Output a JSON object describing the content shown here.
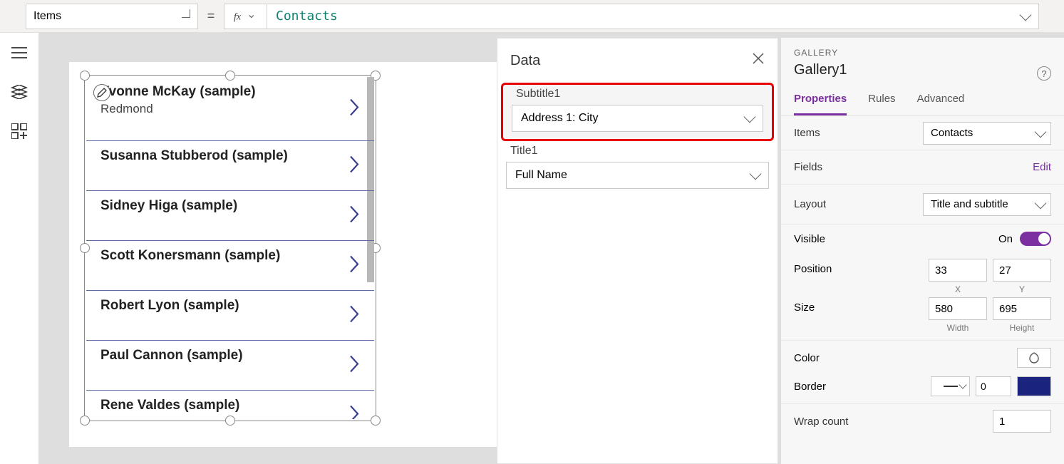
{
  "formula_bar": {
    "property_selected": "Items",
    "formula_value": "Contacts"
  },
  "gallery": {
    "items": [
      {
        "title": "Yvonne McKay (sample)",
        "subtitle": "Redmond"
      },
      {
        "title": "Susanna Stubberod (sample)",
        "subtitle": ""
      },
      {
        "title": "Sidney Higa (sample)",
        "subtitle": ""
      },
      {
        "title": "Scott Konersmann (sample)",
        "subtitle": ""
      },
      {
        "title": "Robert Lyon (sample)",
        "subtitle": ""
      },
      {
        "title": "Paul Cannon (sample)",
        "subtitle": ""
      },
      {
        "title": "Rene Valdes (sample)",
        "subtitle": ""
      }
    ]
  },
  "data_panel": {
    "title": "Data",
    "subtitle_field": {
      "label": "Subtitle1",
      "value": "Address 1: City"
    },
    "title_field": {
      "label": "Title1",
      "value": "Full Name"
    }
  },
  "properties_panel": {
    "category": "GALLERY",
    "control_name": "Gallery1",
    "tabs": {
      "properties": "Properties",
      "rules": "Rules",
      "advanced": "Advanced"
    },
    "items_label": "Items",
    "items_value": "Contacts",
    "fields_label": "Fields",
    "fields_link": "Edit",
    "layout_label": "Layout",
    "layout_value": "Title and subtitle",
    "visible_label": "Visible",
    "visible_on": "On",
    "position_label": "Position",
    "position_x": "33",
    "position_y": "27",
    "x_label": "X",
    "y_label": "Y",
    "size_label": "Size",
    "size_w": "580",
    "size_h": "695",
    "w_label": "Width",
    "h_label": "Height",
    "color_label": "Color",
    "border_label": "Border",
    "border_width": "0",
    "wrap_label": "Wrap count",
    "wrap_value": "1"
  }
}
